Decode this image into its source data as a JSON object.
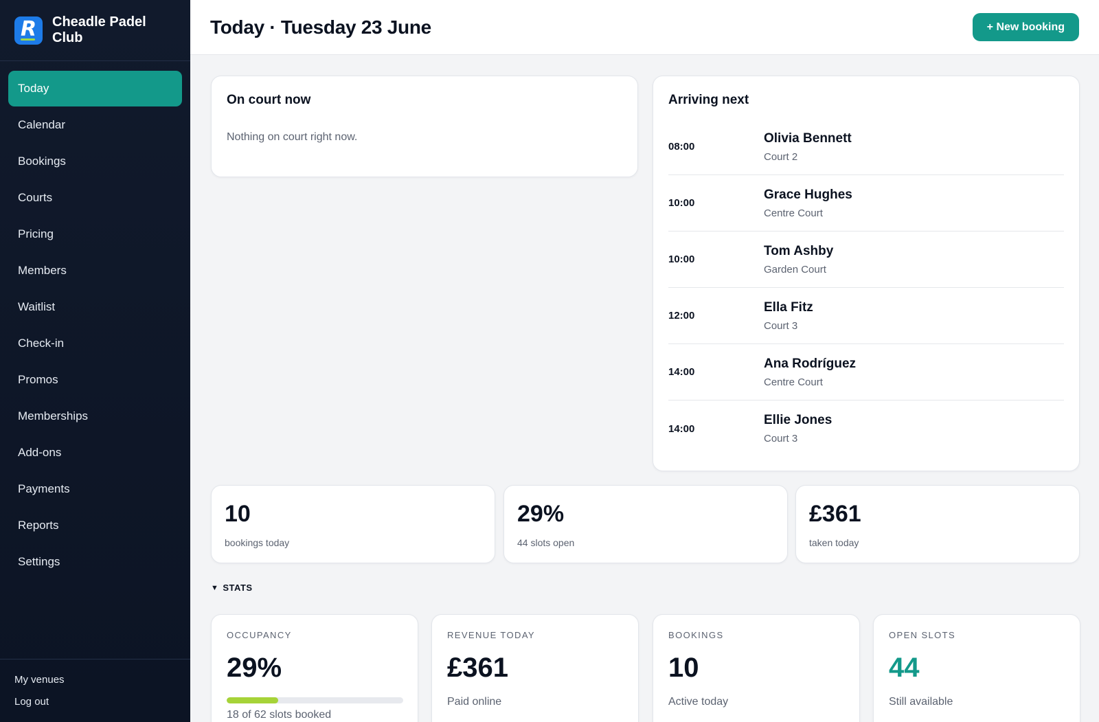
{
  "brand": {
    "name": "Cheadle Padel Club",
    "logo_letter": "R"
  },
  "nav": [
    {
      "label": "Today",
      "active": true
    },
    {
      "label": "Calendar"
    },
    {
      "label": "Bookings"
    },
    {
      "label": "Courts"
    },
    {
      "label": "Pricing"
    },
    {
      "label": "Members"
    },
    {
      "label": "Waitlist"
    },
    {
      "label": "Check-in"
    },
    {
      "label": "Promos"
    },
    {
      "label": "Memberships"
    },
    {
      "label": "Add-ons"
    },
    {
      "label": "Payments"
    },
    {
      "label": "Reports"
    },
    {
      "label": "Settings"
    }
  ],
  "footer": {
    "my_venues": "My venues",
    "log_out": "Log out"
  },
  "header": {
    "title": "Today · Tuesday 23 June",
    "new_booking": "+ New booking"
  },
  "on_court": {
    "title": "On court now",
    "empty": "Nothing on court right now."
  },
  "arriving": {
    "title": "Arriving next",
    "rows": [
      {
        "time": "08:00",
        "name": "Olivia Bennett",
        "court": "Court 2"
      },
      {
        "time": "10:00",
        "name": "Grace Hughes",
        "court": "Centre Court"
      },
      {
        "time": "10:00",
        "name": "Tom Ashby",
        "court": "Garden Court"
      },
      {
        "time": "12:00",
        "name": "Ella Fitz",
        "court": "Court 3"
      },
      {
        "time": "14:00",
        "name": "Ana Rodríguez",
        "court": "Centre Court"
      },
      {
        "time": "14:00",
        "name": "Ellie Jones",
        "court": "Court 3"
      }
    ]
  },
  "kpis": [
    {
      "value": "10",
      "label": "bookings today"
    },
    {
      "value": "29%",
      "label": "44 slots open"
    },
    {
      "value": "£361",
      "label": "taken today"
    }
  ],
  "stats_toggle": "STATS",
  "stats": {
    "occupancy": {
      "label": "OCCUPANCY",
      "value": "29%",
      "sub": "18 of 62 slots booked",
      "progress": 0.29
    },
    "revenue": {
      "label": "REVENUE TODAY",
      "value": "£361",
      "sub": "Paid online"
    },
    "bookings": {
      "label": "BOOKINGS",
      "value": "10",
      "sub": "Active today"
    },
    "open_slots": {
      "label": "OPEN SLOTS",
      "value": "44",
      "sub": "Still available"
    }
  },
  "colors": {
    "accent": "#13998a",
    "sidebar": "#111a2c",
    "progress": "#a6d338",
    "logo": "#1d7be8"
  }
}
